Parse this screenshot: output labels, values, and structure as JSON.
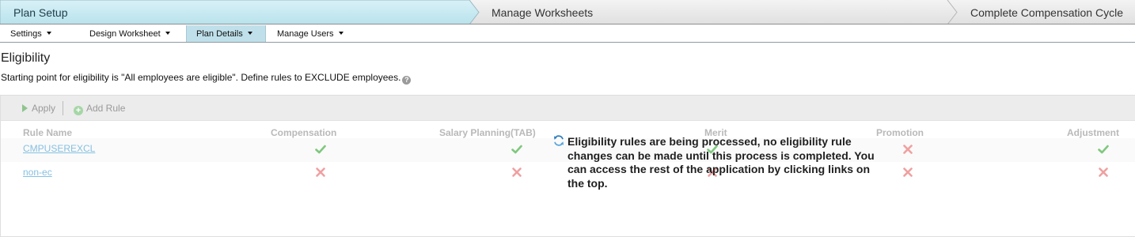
{
  "steps": [
    {
      "label": "Plan Setup",
      "active": true
    },
    {
      "label": "Manage Worksheets",
      "active": false
    },
    {
      "label": "Complete Compensation Cycle",
      "active": false
    }
  ],
  "subtabs": [
    {
      "label": "Settings",
      "active": false
    },
    {
      "label": "Design Worksheet",
      "active": false
    },
    {
      "label": "Plan Details",
      "active": true
    },
    {
      "label": "Manage Users",
      "active": false
    }
  ],
  "page": {
    "title": "Eligibility",
    "description": "Starting point for eligibility is \"All employees are eligible\". Define rules to EXCLUDE employees.",
    "help_icon": "question-mark-icon"
  },
  "toolbar": {
    "apply_label": "Apply",
    "add_rule_label": "Add Rule"
  },
  "table": {
    "columns": [
      "Rule Name",
      "Compensation",
      "Salary Planning(TAB)",
      "Merit",
      "Promotion",
      "Adjustment"
    ],
    "rows": [
      {
        "name": "CMPUSEREXCL",
        "values": [
          "check",
          "check",
          "check",
          "cross",
          "check"
        ]
      },
      {
        "name": "non-ec",
        "values": [
          "cross",
          "cross",
          "cross",
          "cross",
          "cross"
        ]
      }
    ]
  },
  "message": {
    "icon": "refresh-icon",
    "text": "Eligibility rules are being processed, no eligibility rule changes can be made until this process is completed. You can access the rest of the application by clicking links on the top."
  },
  "colors": {
    "active_step": "#c8e9f1",
    "active_tab": "#bfe0ea",
    "check": "#7fc87f",
    "cross": "#f0a0a0",
    "link": "#86c0e0"
  }
}
